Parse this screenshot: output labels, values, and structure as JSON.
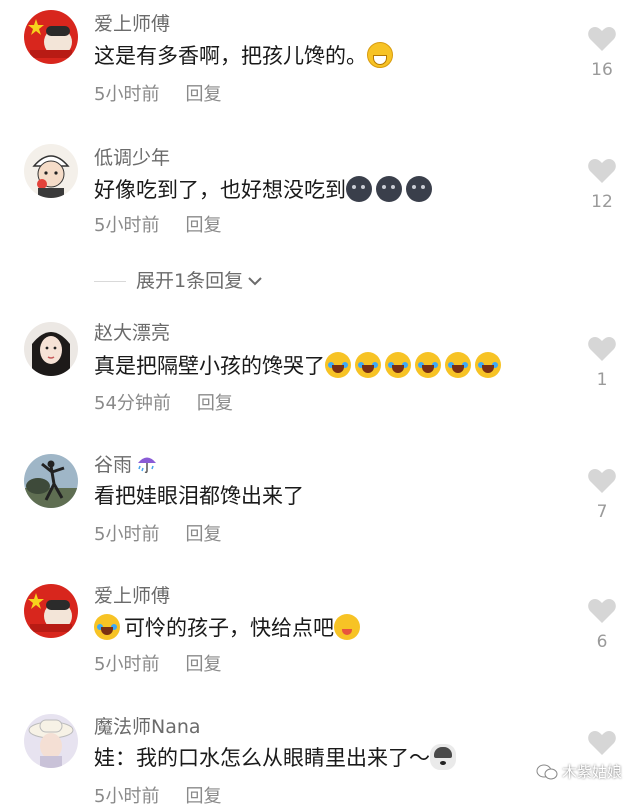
{
  "comments": [
    {
      "username": "爱上师傅",
      "text": "这是有多香啊，把孩儿馋的。",
      "time": "5小时前",
      "reply": "回复",
      "likes": "16",
      "avatar_icon": "flag-avatar",
      "emoji_after": [
        "grinning-emoji"
      ]
    },
    {
      "username": "低调少年",
      "text": "好像吃到了，也好想没吃到",
      "time": "5小时前",
      "reply": "回复",
      "likes": "12",
      "avatar_icon": "cartoon-boy-avatar",
      "emoji_after": [
        "dark-face-emoji",
        "dark-face-emoji",
        "dark-face-emoji"
      ]
    },
    {
      "username": "赵大漂亮",
      "text": "真是把隔壁小孩的馋哭了",
      "time": "54分钟前",
      "reply": "回复",
      "likes": "1",
      "avatar_icon": "woman-avatar",
      "emoji_after": [
        "laughing-tears-emoji",
        "laughing-tears-emoji",
        "laughing-tears-emoji",
        "laughing-tears-emoji",
        "laughing-tears-emoji",
        "laughing-tears-emoji"
      ]
    },
    {
      "username": "谷雨",
      "text": "看把娃眼泪都馋出来了",
      "time": "5小时前",
      "reply": "回复",
      "likes": "7",
      "avatar_icon": "dancer-avatar",
      "name_icon": "umbrella-rain-icon"
    },
    {
      "username": "爱上师傅",
      "text": "可怜的孩子，快给点吧",
      "time": "5小时前",
      "reply": "回复",
      "likes": "6",
      "avatar_icon": "flag-avatar",
      "emoji_before": [
        "laughing-tears-emoji"
      ],
      "emoji_after": [
        "yum-emoji"
      ]
    },
    {
      "username": "魔法师Nana",
      "text": "娃：我的口水怎么从眼睛里出来了～",
      "time": "5小时前",
      "reply": "回复",
      "likes": "",
      "avatar_icon": "girl-hat-avatar",
      "emoji_after": [
        "husky-emoji"
      ]
    }
  ],
  "expand_replies": "展开1条回复",
  "watermark": "木紫姑娘",
  "colors": {
    "username": "#6b6b6b",
    "text": "#1a1a1a",
    "meta": "#8a8a8a",
    "heart": "#d6d6d6"
  }
}
